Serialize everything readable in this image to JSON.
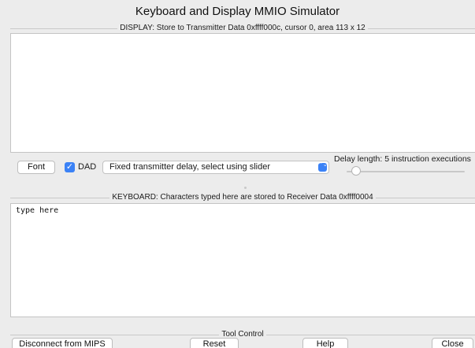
{
  "window": {
    "title": "Keyboard and Display MMIO Simulator"
  },
  "display": {
    "group_title": "DISPLAY: Store to Transmitter Data 0xffff000c, cursor 0, area 113 x 12",
    "content": ""
  },
  "controls": {
    "font_button": "Font",
    "dad_checked": true,
    "dad_check_glyph": "✓",
    "dad_label": "DAD",
    "delay_mode_selected": "Fixed transmitter delay, select using slider",
    "select_arrow_glyph": "⌃⌄",
    "delay_label": "Delay length: 5 instruction executions",
    "delay_value": 5
  },
  "keyboard": {
    "group_title": "KEYBOARD: Characters typed here are stored to Receiver Data 0xffff0004",
    "content": "type here"
  },
  "tool_control": {
    "group_title": "Tool Control",
    "disconnect_button": "Disconnect from MIPS",
    "reset_button": "Reset",
    "help_button": "Help",
    "close_button": "Close"
  },
  "colors": {
    "accent": "#3b82f6",
    "background": "#ececec",
    "text_area": "#ffffff"
  }
}
